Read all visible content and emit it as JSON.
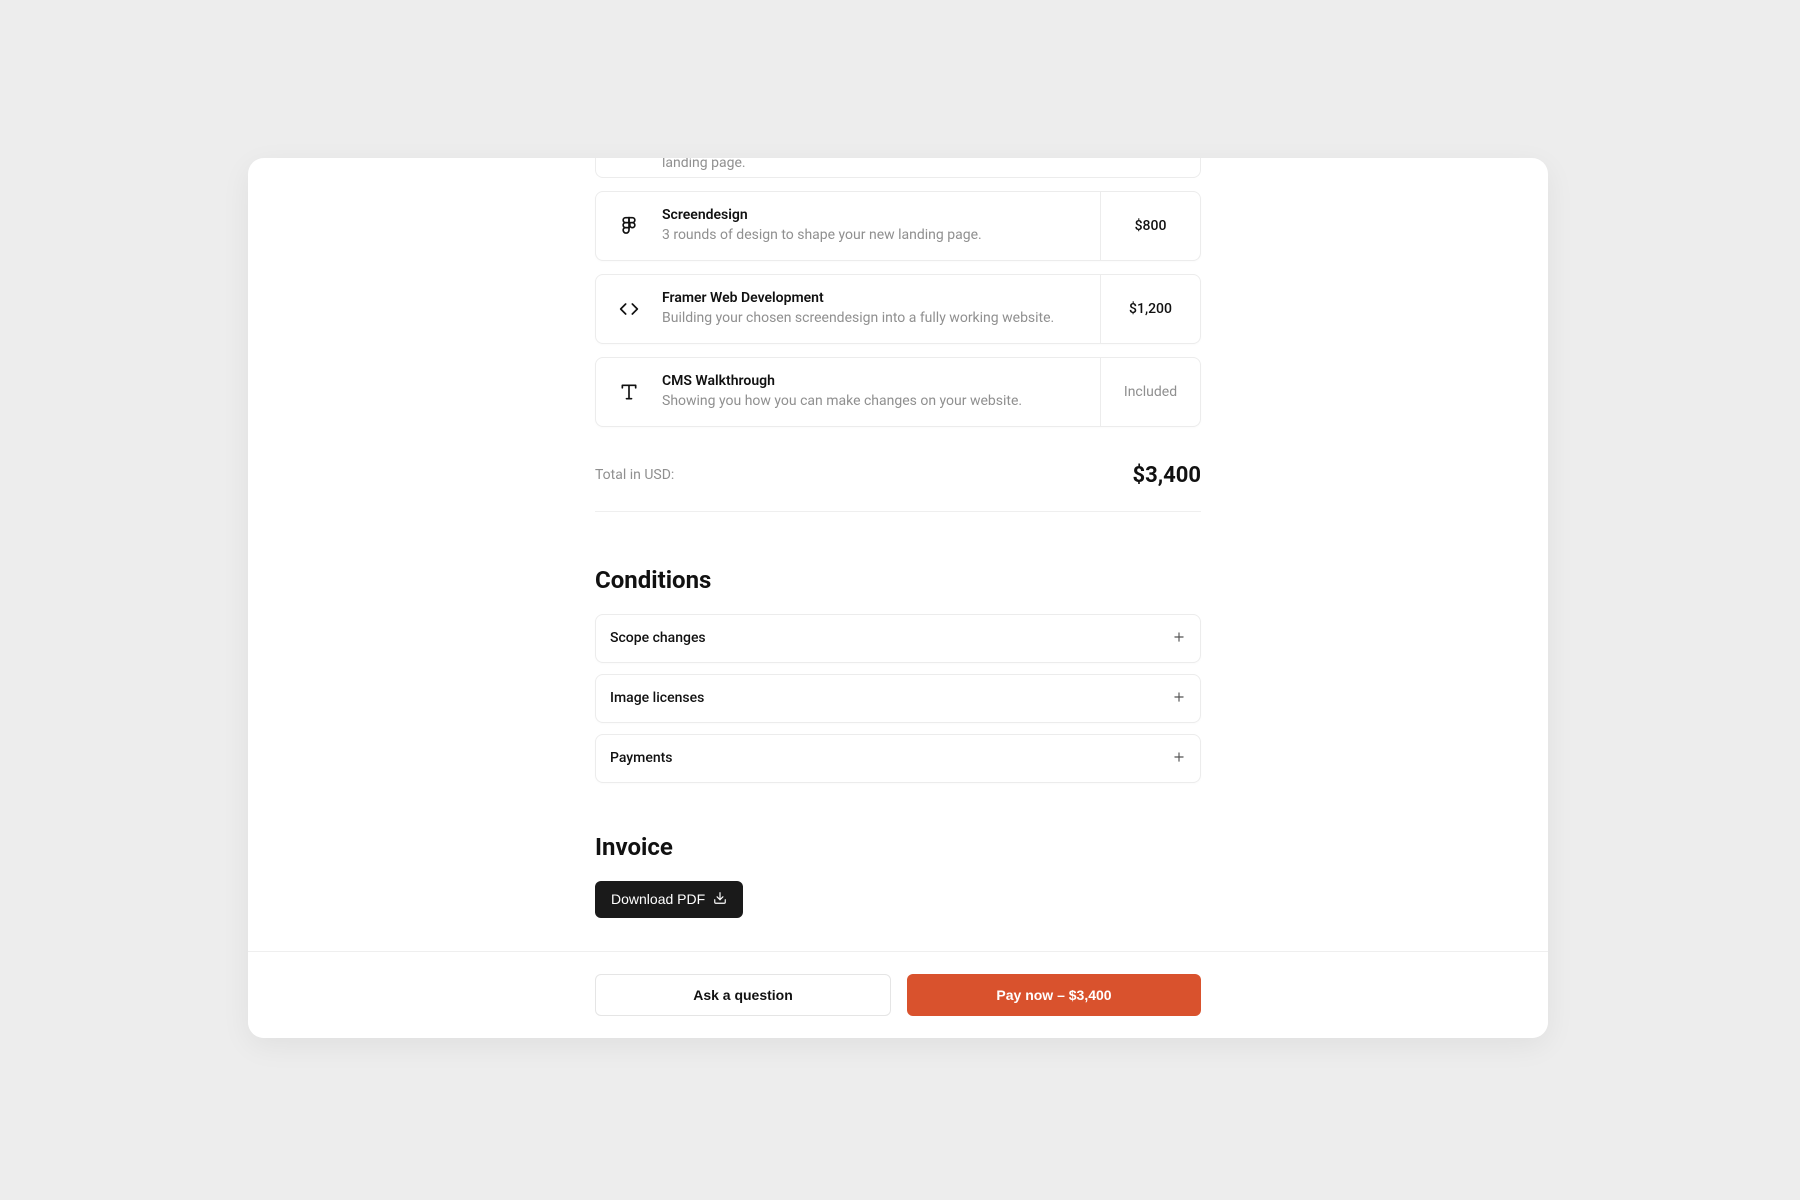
{
  "partial_item": {
    "description_tail": "landing page."
  },
  "line_items": [
    {
      "icon": "figma-icon",
      "title": "Screendesign",
      "description": "3 rounds of design to shape your new landing page.",
      "price": "$800",
      "included": false
    },
    {
      "icon": "code-icon",
      "title": "Framer Web Development",
      "description": "Building your chosen screendesign into a fully working website.",
      "price": "$1,200",
      "included": false
    },
    {
      "icon": "type-icon",
      "title": "CMS Walkthrough",
      "description": "Showing you how you can make changes on your website.",
      "price": "Included",
      "included": true
    }
  ],
  "total": {
    "label": "Total in USD:",
    "amount": "$3,400"
  },
  "conditions": {
    "heading": "Conditions",
    "items": [
      {
        "label": "Scope changes"
      },
      {
        "label": "Image licenses"
      },
      {
        "label": "Payments"
      }
    ]
  },
  "invoice": {
    "heading": "Invoice",
    "download_label": "Download PDF"
  },
  "footer": {
    "ask_label": "Ask a question",
    "pay_label": "Pay now – $3,400"
  }
}
